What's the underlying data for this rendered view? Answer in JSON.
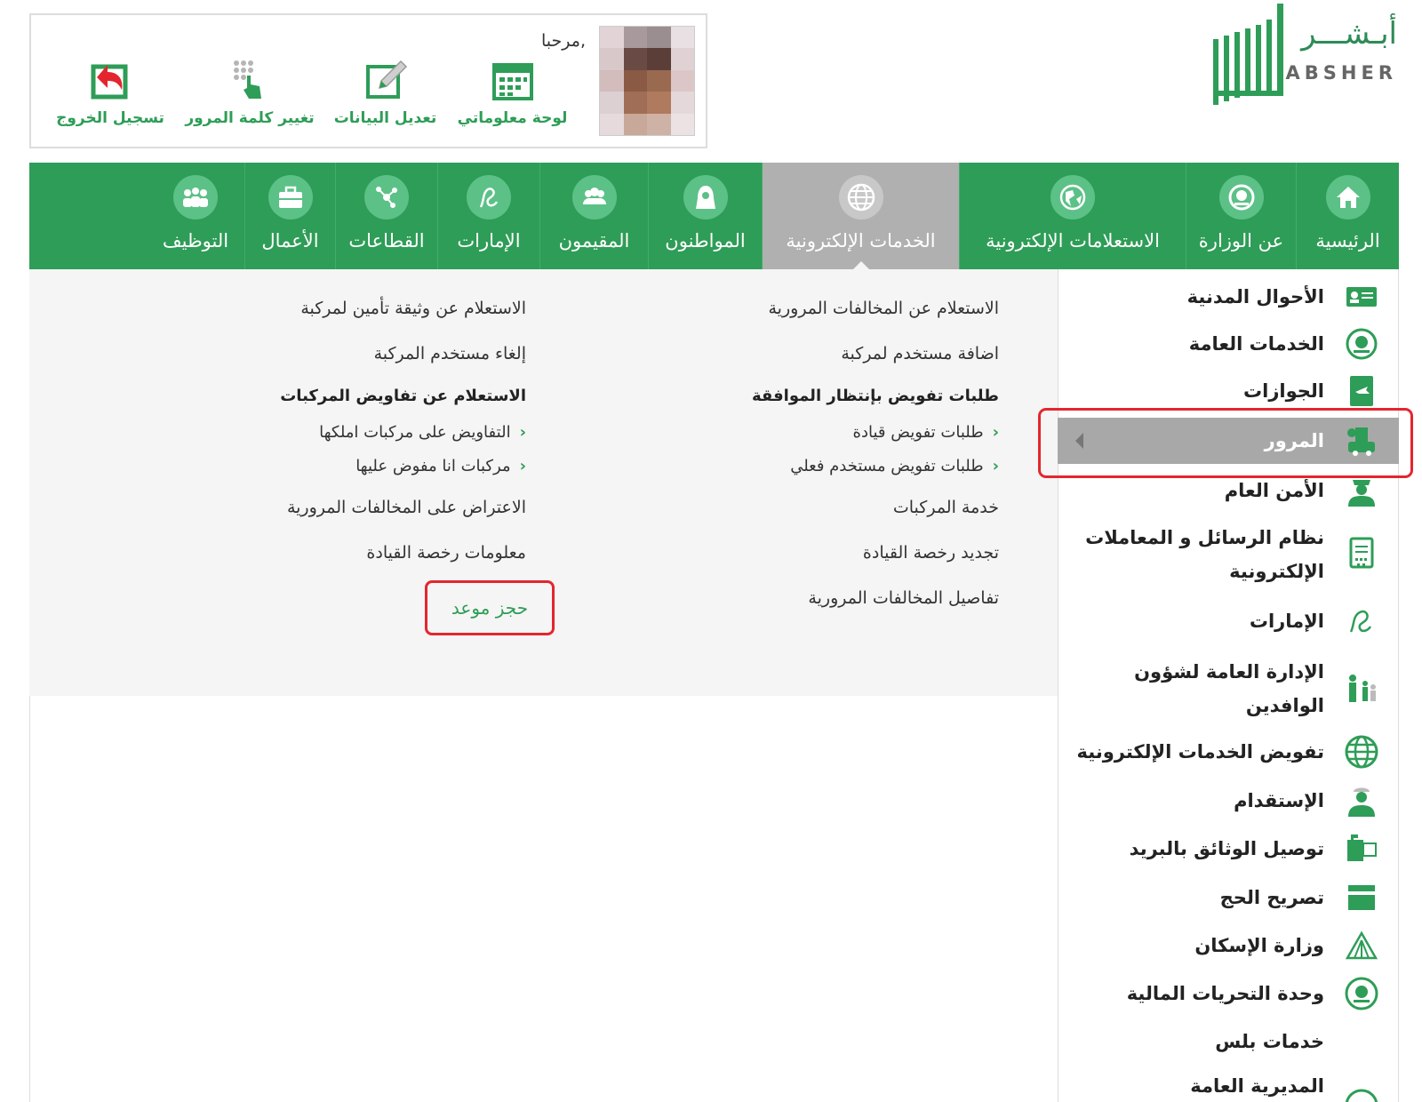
{
  "logo": {
    "arabic": "أبـشـــر",
    "english": "ABSHER"
  },
  "user": {
    "welcome": "مرحبا,",
    "actions": [
      {
        "label": "لوحة معلوماتي",
        "icon": "calendar-icon"
      },
      {
        "label": "تعديل البيانات",
        "icon": "edit-icon"
      },
      {
        "label": "تغيير كلمة المرور",
        "icon": "keypad-hand-icon"
      },
      {
        "label": "تسجيل الخروج",
        "icon": "logout-icon"
      }
    ]
  },
  "nav": [
    {
      "label": "الرئيسية",
      "icon": "home-icon"
    },
    {
      "label": "عن الوزارة",
      "icon": "ministry-emblem-icon"
    },
    {
      "label": "الاستعلامات الإلكترونية",
      "icon": "globe-map-icon"
    },
    {
      "label": "الخدمات الإلكترونية",
      "icon": "globe-icon",
      "active": true
    },
    {
      "label": "المواطنون",
      "icon": "citizen-icon"
    },
    {
      "label": "المقيمون",
      "icon": "residents-icon"
    },
    {
      "label": "الإمارات",
      "icon": "emirates-icon"
    },
    {
      "label": "القطاعات",
      "icon": "sectors-icon"
    },
    {
      "label": "الأعمال",
      "icon": "briefcase-icon"
    },
    {
      "label": "التوظيف",
      "icon": "employment-icon"
    }
  ],
  "right_column": {
    "links_top": [
      "الاستعلام عن المخالفات المرورية",
      "اضافة مستخدم لمركبة"
    ],
    "heading": "طلبات تفويض بإنتظار الموافقة",
    "subs": [
      "طلبات تفويض قيادة",
      "طلبات تفويض مستخدم فعلي"
    ],
    "links_bottom": [
      "خدمة المركبات",
      "تجديد رخصة القيادة",
      "تفاصيل المخالفات المرورية"
    ]
  },
  "left_column": {
    "links_top": [
      "الاستعلام عن وثيقة تأمين لمركبة",
      "إلغاء مستخدم المركبة"
    ],
    "heading": "الاستعلام عن تفاويض المركبات",
    "subs": [
      "التفاويض على مركبات املكها",
      "مركبات انا مفوض عليها"
    ],
    "links_bottom": [
      "الاعتراض على المخالفات المرورية",
      "معلومات رخصة القيادة"
    ],
    "book_appointment": "حجز موعد"
  },
  "sidebar": [
    {
      "label": "الأحوال المدنية",
      "icon": "id-card-icon"
    },
    {
      "label": "الخدمات العامة",
      "icon": "ministry-emblem-icon"
    },
    {
      "label": "الجوازات",
      "icon": "passport-icon"
    },
    {
      "label": "المرور",
      "icon": "traffic-icon",
      "active": true
    },
    {
      "label": "الأمن العام",
      "icon": "police-icon"
    },
    {
      "label": "نظام الرسائل و المعاملات الإلكترونية",
      "icon": "document-icon"
    },
    {
      "label": "الإمارات",
      "icon": "emirates-icon"
    },
    {
      "label": "الإدارة العامة لشؤون الوافدين",
      "icon": "family-icon"
    },
    {
      "label": "تفويض الخدمات الإلكترونية",
      "icon": "globe-icon"
    },
    {
      "label": "الإستقدام",
      "icon": "worker-icon"
    },
    {
      "label": "توصيل الوثائق بالبريد",
      "icon": "mailbox-icon"
    },
    {
      "label": "تصريح الحج",
      "icon": "kaaba-icon"
    },
    {
      "label": "وزارة الإسكان",
      "icon": "housing-icon"
    },
    {
      "label": "وحدة التحريات المالية",
      "icon": "ministry-emblem-icon"
    },
    {
      "label": "خدمات بلس",
      "icon": ""
    },
    {
      "label": "المديرية العامة",
      "icon": "ministry-emblem-icon"
    }
  ],
  "colors": {
    "green": "#2e9d57",
    "active_gray": "#b0b0b0",
    "highlight_red": "#e3262e"
  }
}
